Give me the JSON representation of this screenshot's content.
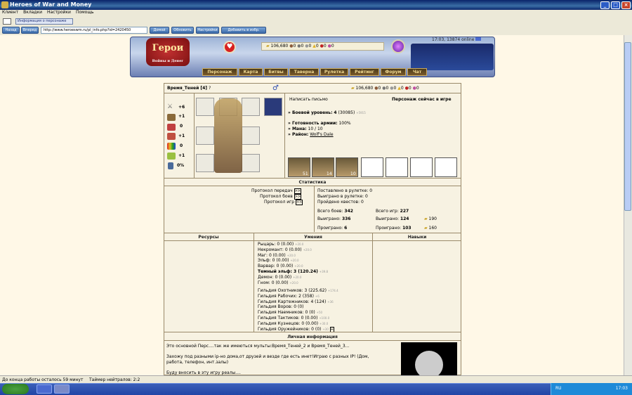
{
  "window": {
    "title": "Heroes of War and Money"
  },
  "menu": [
    "Клиент",
    "Вкладки",
    "Настройки",
    "Помощь"
  ],
  "tab": {
    "label": "Информация о персонаже"
  },
  "nav": {
    "back": "Назад",
    "forward": "Вперед",
    "url": "http://www.heroeswm.ru/pl_info.php?id=2420450",
    "home": "Домой",
    "refresh": "Обновить",
    "settings": "Настройки",
    "addfav": "Добавить в избр."
  },
  "header": {
    "clock": "17:03, 13874 online",
    "gold": "106,680",
    "res": [
      "0",
      "0",
      "0",
      "0",
      "0",
      "0"
    ],
    "logo_title": "Герои",
    "logo_sub": "Войны и Денег"
  },
  "mainnav": [
    "Персонаж",
    "Карта",
    "Битвы",
    "Таверна",
    "Рулетка",
    "Рейтинг",
    "Форум",
    "Чат"
  ],
  "player": {
    "name": "Время_Теней",
    "level": "[4]",
    "gold": "106,680",
    "res": [
      "0",
      "0",
      "0",
      "0",
      "0",
      "0"
    ],
    "write_letter": "Написать письмо",
    "status": "Персонаж сейчас в игре",
    "combat_level_label": "» Боевой уровень:",
    "combat_level": "4",
    "combat_exp": "(30085)",
    "combat_next": "+5915",
    "army_ready_label": "» Готовность армии:",
    "army_ready": "100%",
    "mana_label": "» Мана:",
    "mana": "10 / 10",
    "district_label": "» Район:",
    "district": "Wolf's Dale",
    "stats": [
      "+6",
      "+1",
      "0",
      "+1",
      "0",
      "+1",
      "0%"
    ],
    "army_counts": [
      "51",
      "14",
      "10",
      "",
      "",
      "",
      ""
    ]
  },
  "statistics": {
    "title": "Статистика",
    "protocols": [
      "Протокол передач",
      "Протокол боев",
      "Протокол игр"
    ],
    "roulette_bet": "Поставлено в рулетке: 0",
    "roulette_won": "Выиграно в рулетке: 0",
    "quests": "Пройдено квестов: 0",
    "battles_total_label": "Всего боев:",
    "battles_total": "342",
    "battles_won_label": "Выиграно:",
    "battles_won": "336",
    "battles_lost_label": "Проиграно:",
    "battles_lost": "6",
    "games_total_label": "Всего игр:",
    "games_total": "227",
    "games_won_label": "Выиграно:",
    "games_won": "124",
    "games_lost_label": "Проиграно:",
    "games_lost": "103",
    "gold_won": "190",
    "gold_lost": "160"
  },
  "sections": {
    "resources": "Ресурсы",
    "skills": "Умения",
    "abilities": "Навыки",
    "personal": "Личная информация"
  },
  "skills": [
    {
      "name": "Рыцарь:",
      "val": "0 (0.00)",
      "next": "+20.0",
      "bold": false
    },
    {
      "name": "Некромант:",
      "val": "0 (0.00)",
      "next": "+20.0",
      "bold": false
    },
    {
      "name": "Маг:",
      "val": "0 (0.00)",
      "next": "+20.0",
      "bold": false
    },
    {
      "name": "Эльф:",
      "val": "0 (0.00)",
      "next": "+20.0",
      "bold": false
    },
    {
      "name": "Варвар:",
      "val": "0 (0.00)",
      "next": "+20.0",
      "bold": false
    },
    {
      "name": "Темный эльф:",
      "val": "3 (120.24)",
      "next": "+39.8",
      "bold": true
    },
    {
      "name": "Демон:",
      "val": "0 (0.00)",
      "next": "+20.0",
      "bold": false
    },
    {
      "name": "Гном:",
      "val": "0 (0.00)",
      "next": "+20.0",
      "bold": false
    }
  ],
  "guilds": [
    {
      "name": "Гильдия Охотников:",
      "val": "3 (225.62)",
      "next": "+174.4"
    },
    {
      "name": "Гильдия Рабочих:",
      "val": "2 (358)",
      "next": "+6"
    },
    {
      "name": "Гильдия Картежников:",
      "val": "4 (124)",
      "next": "+36"
    },
    {
      "name": "Гильдия Воров:",
      "val": "0 (0)",
      "next": ""
    },
    {
      "name": "Гильдия Наемников:",
      "val": "0 (0)",
      "next": "+50"
    },
    {
      "name": "Гильдия Тактиков:",
      "val": "0 (0.00)",
      "next": "+100.0"
    },
    {
      "name": "Гильдия Кузнецов:",
      "val": "0 (0.00)",
      "next": "+30.0"
    },
    {
      "name": "Гильдия Оружейников:",
      "val": "0 (0)",
      "next": "+30"
    }
  ],
  "personal": {
    "line1": "Это основной Перс....так же имеються мульты:Время_Теней_2 и Время_Теней_3...",
    "line2": "Захожу под разными ip-но дома,от друзей и везде где есть инет!Играю с разных IP! (Дом,",
    "line3": "работа, телефон, инт.залы)",
    "line4": "Буду вносить в эту игру реалы...."
  },
  "status_bar": {
    "left": "До конца работы осталось 59 минут",
    "mid": "Таймер нейтралов: 2:2"
  },
  "tray": {
    "lang": "RU",
    "time": "17:03"
  }
}
